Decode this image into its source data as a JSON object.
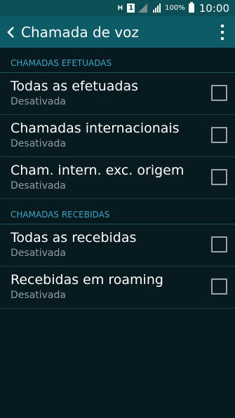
{
  "status_bar": {
    "network_type": "H",
    "sim": "1",
    "battery_percent": "100%",
    "time": "10:00"
  },
  "header": {
    "title": "Chamada de voz"
  },
  "sections": [
    {
      "label": "CHAMADAS EFETUADAS",
      "items": [
        {
          "title": "Todas as efetuadas",
          "subtitle": "Desativada",
          "checked": false
        },
        {
          "title": "Chamadas internacionais",
          "subtitle": "Desativada",
          "checked": false
        },
        {
          "title": "Cham. intern. exc. origem",
          "subtitle": "Desativada",
          "checked": false
        }
      ]
    },
    {
      "label": "CHAMADAS RECEBIDAS",
      "items": [
        {
          "title": "Todas as recebidas",
          "subtitle": "Desativada",
          "checked": false
        },
        {
          "title": "Recebidas em roaming",
          "subtitle": "Desativada",
          "checked": false
        }
      ]
    }
  ]
}
